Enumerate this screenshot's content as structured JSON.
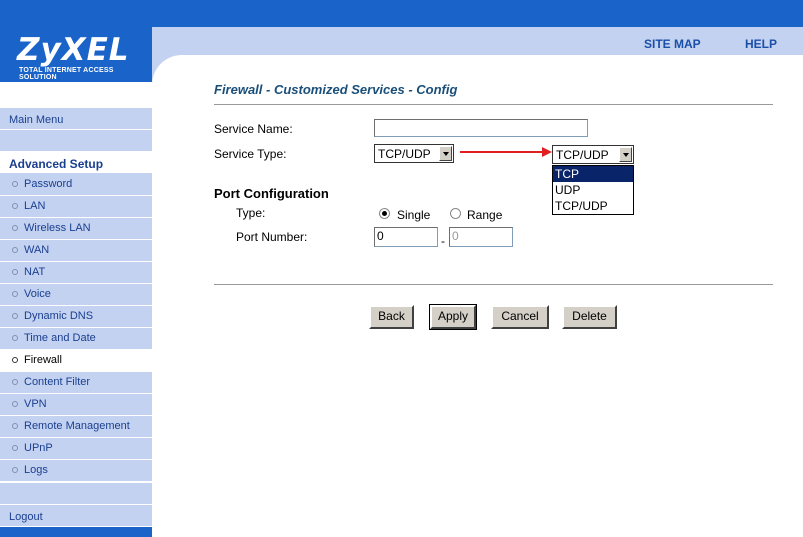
{
  "brand": {
    "name": "ZyXEL",
    "tagline": "TOTAL INTERNET ACCESS SOLUTION"
  },
  "header": {
    "site_map": "SITE MAP",
    "help": "HELP"
  },
  "sidebar": {
    "main_menu": "Main Menu",
    "advanced_setup": "Advanced Setup",
    "items": [
      {
        "label": "Password"
      },
      {
        "label": "LAN"
      },
      {
        "label": "Wireless LAN"
      },
      {
        "label": "WAN"
      },
      {
        "label": "NAT"
      },
      {
        "label": "Voice"
      },
      {
        "label": "Dynamic DNS"
      },
      {
        "label": "Time and Date"
      },
      {
        "label": "Firewall",
        "active": true
      },
      {
        "label": "Content Filter"
      },
      {
        "label": "VPN"
      },
      {
        "label": "Remote Management"
      },
      {
        "label": "UPnP"
      },
      {
        "label": "Logs"
      }
    ],
    "logout": "Logout"
  },
  "page": {
    "title": "Firewall - Customized Services - Config",
    "service_name_label": "Service Name:",
    "service_name_value": "",
    "service_type_label": "Service Type:",
    "service_type_value": "TCP/UDP",
    "service_type_open_value": "TCP/UDP",
    "service_type_options": [
      "TCP",
      "UDP",
      "TCP/UDP"
    ],
    "service_type_highlighted": "TCP",
    "port_config_title": "Port Configuration",
    "type_label": "Type:",
    "type_options": {
      "single": "Single",
      "range": "Range"
    },
    "type_selected": "single",
    "port_number_label": "Port Number:",
    "port_start": "0",
    "port_separator": "-",
    "port_end": "0",
    "buttons": {
      "back": "Back",
      "apply": "Apply",
      "cancel": "Cancel",
      "delete": "Delete"
    }
  },
  "colors": {
    "brand_blue": "#1a63c8",
    "nav_bg": "#c4d2f2",
    "annotation_arrow": "#e02020"
  }
}
